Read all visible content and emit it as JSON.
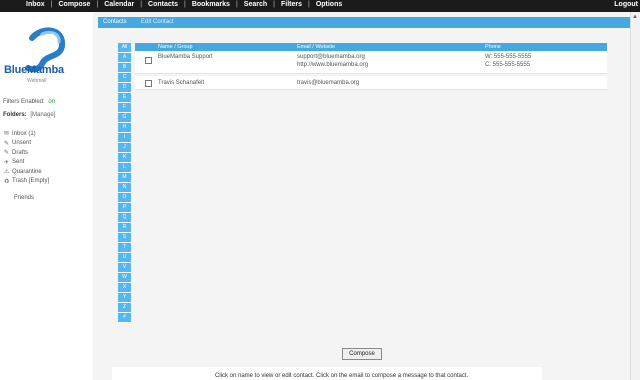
{
  "nav": {
    "items": [
      "Inbox",
      "Compose",
      "Calendar",
      "Contacts",
      "Bookmarks",
      "Search",
      "Filters",
      "Options"
    ],
    "logout": "Logout"
  },
  "sidebar": {
    "logo_main": "BlueMamba",
    "logo_sub": "Webmail",
    "filters_label": "Filters Enabled:",
    "filters_value": "on",
    "folders_label": "Folders:",
    "manage": "[Manage]",
    "folders": [
      {
        "icon": "inbox-icon",
        "glyph": "✉",
        "label": "Inbox  (1)"
      },
      {
        "icon": "unsent-icon",
        "glyph": "✎",
        "label": "Unsent"
      },
      {
        "icon": "drafts-icon",
        "glyph": "✎",
        "label": "Drafts"
      },
      {
        "icon": "sent-icon",
        "glyph": "✈",
        "label": "Sent"
      },
      {
        "icon": "quarantine-icon",
        "glyph": "⚠",
        "label": "Quarantine"
      },
      {
        "icon": "trash-icon",
        "glyph": "🗑",
        "label": "Trash  [Empty]"
      }
    ],
    "friends": "Friends"
  },
  "tabs": {
    "active": "Contacts",
    "second": "Edit Contact"
  },
  "letters": [
    "All",
    "A",
    "B",
    "C",
    "D",
    "E",
    "F",
    "G",
    "H",
    "I",
    "J",
    "K",
    "L",
    "M",
    "N",
    "O",
    "P",
    "Q",
    "R",
    "S",
    "T",
    "U",
    "V",
    "W",
    "X",
    "Y",
    "Z",
    "#"
  ],
  "table": {
    "headers": {
      "name": "Name / Group",
      "email": "Email / Website",
      "phone": "Phone"
    },
    "rows": [
      {
        "name": "BlueMamba Support",
        "email": "support@bluemamba.org",
        "website": "http://www.bluemamba.org",
        "phone_w": "W: 555-555-5555",
        "phone_c": "C: 555-555-5555"
      },
      {
        "name": "Travis Schanafelt",
        "email": "travis@bluemamba.org",
        "website": "",
        "phone_w": "",
        "phone_c": ""
      }
    ]
  },
  "compose_button": "Compose",
  "footer_hint": "Click on name to view or edit contact. Click on the email to compose a message to that contact.",
  "colors": {
    "accent": "#45a8e0",
    "nav_bg": "#1b1b1b"
  }
}
